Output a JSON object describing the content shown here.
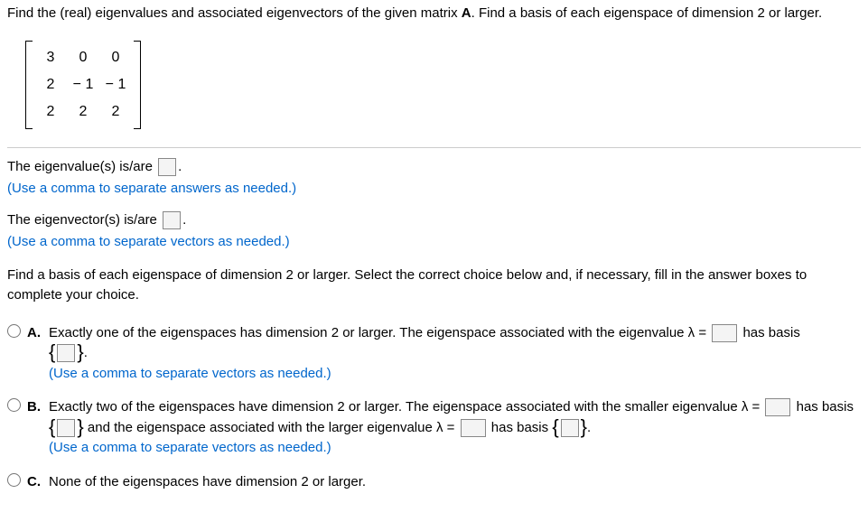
{
  "question": {
    "prompt_line1": "Find the (real) eigenvalues and associated eigenvectors of the given matrix ",
    "prompt_bold": "A",
    "prompt_line2": ". Find a basis of each eigenspace of dimension 2 or larger.",
    "matrix": [
      [
        "3",
        "0",
        "0"
      ],
      [
        "2",
        "− 1",
        "− 1"
      ],
      [
        "2",
        "2",
        "2"
      ]
    ]
  },
  "parts": {
    "eigenvalues_label_pre": "The eigenvalue(s) is/are ",
    "eigenvalues_label_post": ".",
    "eigenvalues_hint": "(Use a comma to separate answers as needed.)",
    "eigenvectors_label_pre": "The eigenvector(s) is/are ",
    "eigenvectors_label_post": ".",
    "eigenvectors_hint": "(Use a comma to separate vectors as needed.)",
    "followup": "Find a basis of each eigenspace of dimension 2 or larger. Select the correct choice below and, if necessary, fill in the answer boxes to complete your choice."
  },
  "choices": {
    "A": {
      "letter": "A.",
      "text1": "Exactly one of the eigenspaces has dimension 2 or larger. The eigenspace associated with the eigenvalue λ = ",
      "text2": " has basis ",
      "text3": ".",
      "hint": "(Use a comma to separate vectors as needed.)"
    },
    "B": {
      "letter": "B.",
      "text1": "Exactly two of the eigenspaces have dimension 2 or larger. The eigenspace associated with the smaller eigenvalue λ = ",
      "text2": " has basis ",
      "text3": " and the eigenspace associated with the larger eigenvalue λ = ",
      "text4": " has basis ",
      "text5": ".",
      "hint": "(Use a comma to separate vectors as needed.)"
    },
    "C": {
      "letter": "C.",
      "text": "None of the eigenspaces have dimension 2 or larger."
    }
  }
}
